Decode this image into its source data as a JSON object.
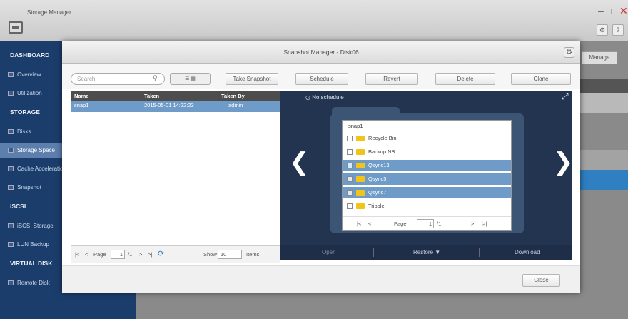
{
  "app": {
    "title": "Storage Manager",
    "controls": [
      "–",
      "+",
      "✕"
    ],
    "toolbar_icons": [
      "⚙",
      "?"
    ]
  },
  "sidebar": {
    "items": [
      {
        "label": "DASHBOARD",
        "type": "head"
      },
      {
        "label": "Overview",
        "type": "item"
      },
      {
        "label": "Utilization",
        "type": "item"
      },
      {
        "label": "STORAGE",
        "type": "head"
      },
      {
        "label": "Disks",
        "type": "item"
      },
      {
        "label": "Storage Space",
        "type": "item",
        "selected": true
      },
      {
        "label": "Cache Acceleration",
        "type": "item"
      },
      {
        "label": "Snapshot",
        "type": "item"
      },
      {
        "label": "iSCSI",
        "type": "head"
      },
      {
        "label": "iSCSI Storage",
        "type": "item"
      },
      {
        "label": "LUN Backup",
        "type": "item"
      },
      {
        "label": "VIRTUAL DISK",
        "type": "head"
      },
      {
        "label": "Remote Disk",
        "type": "item"
      }
    ]
  },
  "bg": {
    "manage_label": "Manage"
  },
  "modal": {
    "title": "Snapshot Manager - Disk06",
    "search_placeholder": "Search",
    "view_toggle": "☰ ▦",
    "buttons": [
      "Take Snapshot",
      "Schedule",
      "Revert",
      "Delete",
      "Clone"
    ],
    "table": {
      "headers": [
        "Name",
        "Taken",
        "Taken By"
      ],
      "rows": [
        {
          "name": "snap1",
          "taken": "2015-05-01 14:22:23",
          "taken_by": "admin"
        }
      ]
    },
    "pager": {
      "first": "|<",
      "prev": "<",
      "page_label": "Page",
      "page": "1",
      "of": "/1",
      "next": ">",
      "last": ">|",
      "refresh": "⟳",
      "show_label": "Show",
      "show_value": "10",
      "items_label": "Items"
    },
    "preview": {
      "no_schedule": "No schedule",
      "prev_arrow": "❮",
      "next_arrow": "❯",
      "expand_icon": "⤢",
      "bar": {
        "open": "Open",
        "restore": "Restore ▼",
        "download": "Download"
      },
      "browser": {
        "folder": "snap1",
        "items": [
          {
            "name": "Recycle Bin",
            "selected": false
          },
          {
            "name": "Backup NB",
            "selected": false
          },
          {
            "name": "Qsync13",
            "selected": true
          },
          {
            "name": "Qsync5",
            "selected": true
          },
          {
            "name": "Qsync7",
            "selected": true
          },
          {
            "name": "Tripple",
            "selected": false
          }
        ],
        "pager": {
          "first": "|<",
          "prev": "<",
          "page_label": "Page",
          "page": "1",
          "of": "/1",
          "next": ">",
          "last": ">|"
        }
      }
    },
    "close_label": "Close"
  }
}
